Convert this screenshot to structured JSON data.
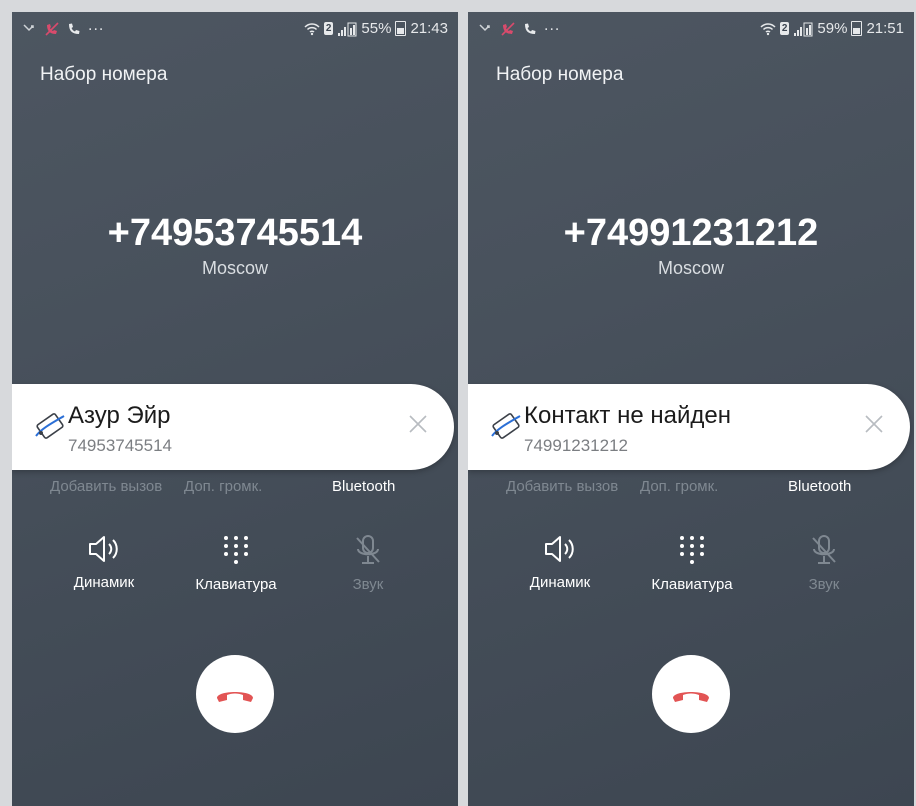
{
  "screens": [
    {
      "status_time": "21:43",
      "battery": "55%",
      "sim": "2",
      "title": "Набор номера",
      "number": "+74953745514",
      "location": "Moscow",
      "card_name": "Азур Эйр",
      "card_number": "74953745514",
      "options": [
        "Добавить вызов",
        "Доп. громк.",
        "Bluetooth"
      ],
      "controls": [
        "Динамик",
        "Клавиатура",
        "Звук"
      ]
    },
    {
      "status_time": "21:51",
      "battery": "59%",
      "sim": "2",
      "title": "Набор номера",
      "number": "+74991231212",
      "location": "Moscow",
      "card_name": "Контакт не найден",
      "card_number": "74991231212",
      "options": [
        "Добавить вызов",
        "Доп. громк.",
        "Bluetooth"
      ],
      "controls": [
        "Динамик",
        "Клавиатура",
        "Звук"
      ]
    }
  ],
  "icons": {
    "status_left": [
      "missed-call-icon",
      "call-active-icon",
      "phone-icon"
    ],
    "status_right": [
      "wifi-icon",
      "sim-badge",
      "signal-icon",
      "battery-icon"
    ],
    "card": "caller-id-icon",
    "close": "close-icon",
    "controls": [
      "speaker-icon",
      "keypad-icon",
      "mic-off-icon"
    ],
    "end": "end-call-icon"
  },
  "colors": {
    "end_call": "#e25454",
    "background": "#48515c",
    "card": "#ffffff",
    "disabled": "#7f8891"
  }
}
